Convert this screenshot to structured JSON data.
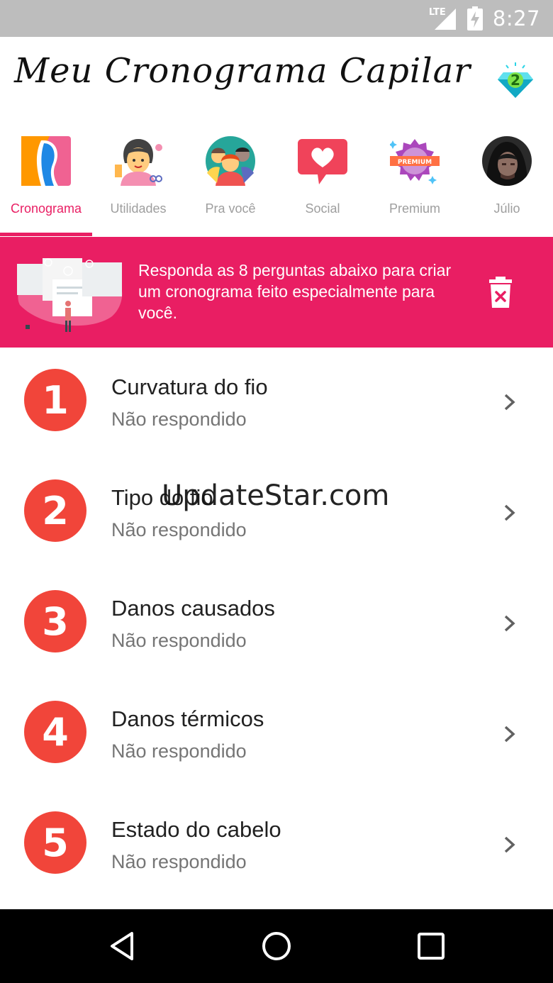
{
  "status_bar": {
    "network": "LTE",
    "time": "8:27"
  },
  "header": {
    "title": "Meu Cronograma Capilar",
    "gem_count": "2"
  },
  "tabs": [
    {
      "label": "Cronograma",
      "icon": "hair-profile-icon",
      "active": true
    },
    {
      "label": "Utilidades",
      "icon": "hairdresser-icon",
      "active": false
    },
    {
      "label": "Pra você",
      "icon": "people-group-icon",
      "active": false
    },
    {
      "label": "Social",
      "icon": "heart-chat-icon",
      "active": false
    },
    {
      "label": "Premium",
      "icon": "premium-badge-icon",
      "active": false,
      "badge_text": "PREMIUM"
    },
    {
      "label": "Júlio",
      "icon": "user-avatar",
      "active": false
    }
  ],
  "banner": {
    "text": "Responda as 8 perguntas abaixo para criar um cronograma feito especialmente para você."
  },
  "questions": [
    {
      "number": "1",
      "title": "Curvatura do fio",
      "status": "Não respondido"
    },
    {
      "number": "2",
      "title": "Tipo do fio",
      "status": "Não respondido"
    },
    {
      "number": "3",
      "title": "Danos causados",
      "status": "Não respondido"
    },
    {
      "number": "4",
      "title": "Danos térmicos",
      "status": "Não respondido"
    },
    {
      "number": "5",
      "title": "Estado do cabelo",
      "status": "Não respondido"
    }
  ],
  "watermark": "UpdateStar.com",
  "colors": {
    "accent": "#e91e63",
    "badge": "#f1453a",
    "status_bar": "#bdbdbd"
  }
}
